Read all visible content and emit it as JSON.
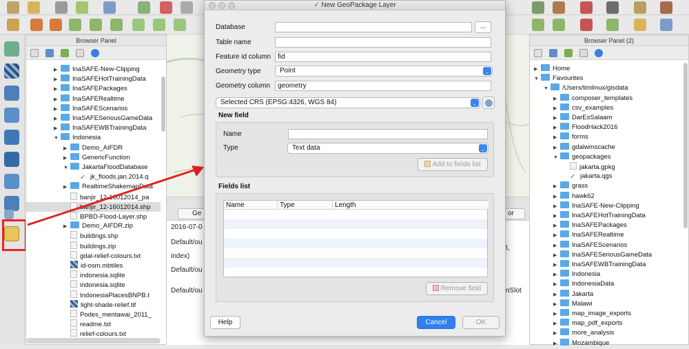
{
  "dialog": {
    "title": "New GeoPackage Layer",
    "database_label": "Database",
    "database_value": "",
    "browse_label": "...",
    "table_name_label": "Table name",
    "table_name_value": "",
    "feature_id_label": "Feature id column",
    "feature_id_value": "fid",
    "geometry_type_label": "Geometry type",
    "geometry_type_value": "Point",
    "geometry_column_label": "Geometry column",
    "geometry_column_value": "geometry",
    "crs_value": "Selected CRS (EPSG:4326, WGS 84)",
    "new_field": {
      "title": "New field",
      "name_label": "Name",
      "name_value": "",
      "type_label": "Type",
      "type_value": "Text data",
      "add_button": "Add to fields list"
    },
    "fields_list": {
      "title": "Fields list",
      "columns": [
        "Name",
        "Type",
        "Length"
      ],
      "remove_button": "Remove field"
    },
    "help_button": "Help",
    "cancel_button": "Cancel",
    "ok_button": "OK"
  },
  "left_panel": {
    "title": "Browser Panel",
    "items": [
      {
        "label": "InaSAFE-New-Clipping",
        "kind": "folder",
        "level": 1,
        "expanded": false
      },
      {
        "label": "InaSAFEHotTrainingData",
        "kind": "folder",
        "level": 1,
        "expanded": false
      },
      {
        "label": "InaSAFEPackages",
        "kind": "folder",
        "level": 1,
        "expanded": false
      },
      {
        "label": "InaSAFERealtime",
        "kind": "folder",
        "level": 1,
        "expanded": false
      },
      {
        "label": "InaSAFEScenarios",
        "kind": "folder",
        "level": 1,
        "expanded": false
      },
      {
        "label": "InaSAFESeriousGameData",
        "kind": "folder",
        "level": 1,
        "expanded": false
      },
      {
        "label": "InaSAFEWBTrainingData",
        "kind": "folder",
        "level": 1,
        "expanded": false
      },
      {
        "label": "Indonesia",
        "kind": "folder",
        "level": 1,
        "expanded": true
      },
      {
        "label": "Demo_AIFDR",
        "kind": "folder",
        "level": 2,
        "expanded": false
      },
      {
        "label": "GenericFunction",
        "kind": "folder",
        "level": 2,
        "expanded": false
      },
      {
        "label": "JakartaFloodDatabase",
        "kind": "folder",
        "level": 2,
        "expanded": true
      },
      {
        "label": "jk_floods.jan.2014.q",
        "kind": "check",
        "level": 3,
        "expanded": false
      },
      {
        "label": "RealtimeShakemapData",
        "kind": "folder",
        "level": 2,
        "expanded": false
      },
      {
        "label": "banjir_12-16012014_pa",
        "kind": "file",
        "level": 2,
        "expanded": false
      },
      {
        "label": "banjir_12-16012014.shp",
        "kind": "file",
        "level": 2,
        "expanded": false,
        "selected": true
      },
      {
        "label": "BPBD-Flood-Layer.shp",
        "kind": "file",
        "level": 2,
        "expanded": false
      },
      {
        "label": "Demo_AIFDR.zip",
        "kind": "folder",
        "level": 2,
        "expanded": false
      },
      {
        "label": "buildings.shp",
        "kind": "file",
        "level": 2,
        "expanded": false
      },
      {
        "label": "buildings.zip",
        "kind": "file",
        "level": 2,
        "expanded": false
      },
      {
        "label": "gdal-relief-colours.txt",
        "kind": "file",
        "level": 2,
        "expanded": false
      },
      {
        "label": "id-osm.mbtiles",
        "kind": "raster",
        "level": 2,
        "expanded": false
      },
      {
        "label": "indonesia.sqlite",
        "kind": "file",
        "level": 2,
        "expanded": false
      },
      {
        "label": "indonesia.sqlite",
        "kind": "file",
        "level": 2,
        "expanded": false
      },
      {
        "label": "IndonesiaPlacesBNPB.t",
        "kind": "file",
        "level": 2,
        "expanded": false
      },
      {
        "label": "light-shade-relief.tif",
        "kind": "raster",
        "level": 2,
        "expanded": false
      },
      {
        "label": "Podes_mentawai_2011_",
        "kind": "file",
        "level": 2,
        "expanded": false
      },
      {
        "label": "readme.txt",
        "kind": "file",
        "level": 2,
        "expanded": false
      },
      {
        "label": "relief-colours.txt",
        "kind": "file",
        "level": 2,
        "expanded": false
      }
    ]
  },
  "right_panel": {
    "title": "Browser Panel (2)",
    "items": [
      {
        "label": "Home",
        "kind": "folder",
        "level": 0,
        "expanded": false
      },
      {
        "label": "Favourites",
        "kind": "folder",
        "level": 0,
        "expanded": true
      },
      {
        "label": "/Users/timlinux/gisdata",
        "kind": "folder",
        "level": 1,
        "expanded": true
      },
      {
        "label": "composer_templates",
        "kind": "folder",
        "level": 2,
        "expanded": false
      },
      {
        "label": "csv_examples",
        "kind": "folder",
        "level": 2,
        "expanded": false
      },
      {
        "label": "DarEsSalaam",
        "kind": "folder",
        "level": 2,
        "expanded": false
      },
      {
        "label": "FloodHack2016",
        "kind": "folder",
        "level": 2,
        "expanded": false
      },
      {
        "label": "forms",
        "kind": "folder",
        "level": 2,
        "expanded": false
      },
      {
        "label": "gdalwmscache",
        "kind": "folder",
        "level": 2,
        "expanded": false
      },
      {
        "label": "geopackages",
        "kind": "folder",
        "level": 2,
        "expanded": true
      },
      {
        "label": "jakarta.gpkg",
        "kind": "file",
        "level": 3,
        "expanded": false
      },
      {
        "label": "jakarta.qgs",
        "kind": "check",
        "level": 3,
        "expanded": false
      },
      {
        "label": "grass",
        "kind": "folder",
        "level": 2,
        "expanded": false
      },
      {
        "label": "hawk62",
        "kind": "folder",
        "level": 2,
        "expanded": false
      },
      {
        "label": "InaSAFE-New-Clipping",
        "kind": "folder",
        "level": 2,
        "expanded": false
      },
      {
        "label": "InaSAFEHotTrainingData",
        "kind": "folder",
        "level": 2,
        "expanded": false
      },
      {
        "label": "InaSAFEPackages",
        "kind": "folder",
        "level": 2,
        "expanded": false
      },
      {
        "label": "InaSAFERealtime",
        "kind": "folder",
        "level": 2,
        "expanded": false
      },
      {
        "label": "InaSAFEScenarios",
        "kind": "folder",
        "level": 2,
        "expanded": false
      },
      {
        "label": "InaSAFESeriousGameData",
        "kind": "folder",
        "level": 2,
        "expanded": false
      },
      {
        "label": "InaSAFEWBTrainingData",
        "kind": "folder",
        "level": 2,
        "expanded": false
      },
      {
        "label": "Indonesia",
        "kind": "folder",
        "level": 2,
        "expanded": false
      },
      {
        "label": "IndonesiaData",
        "kind": "folder",
        "level": 2,
        "expanded": false
      },
      {
        "label": "Jakarta",
        "kind": "folder",
        "level": 2,
        "expanded": false
      },
      {
        "label": "Malawi",
        "kind": "folder",
        "level": 2,
        "expanded": false
      },
      {
        "label": "map_image_exports",
        "kind": "folder",
        "level": 2,
        "expanded": false
      },
      {
        "label": "map_pdf_exports",
        "kind": "folder",
        "level": 2,
        "expanded": false
      },
      {
        "label": "more_analysis",
        "kind": "folder",
        "level": 2,
        "expanded": false
      },
      {
        "label": "Mozambique",
        "kind": "folder",
        "level": 2,
        "expanded": false
      }
    ]
  },
  "log_panel": {
    "tab_left": "Ge",
    "tab_right": "or",
    "lines": [
      {
        "left": "2016-07-0",
        "right": ""
      },
      {
        "left": "Default/ou",
        "right": "t,"
      },
      {
        "left": "index)",
        "right": ""
      },
      {
        "left": "Default/ou",
        "right": ""
      },
      {
        "left": "Default/ou",
        "right": "nSlot"
      }
    ]
  },
  "colors": {
    "folder": "#5aa9e6",
    "accent": "#2f7ff0",
    "highlight": "#e22222"
  }
}
